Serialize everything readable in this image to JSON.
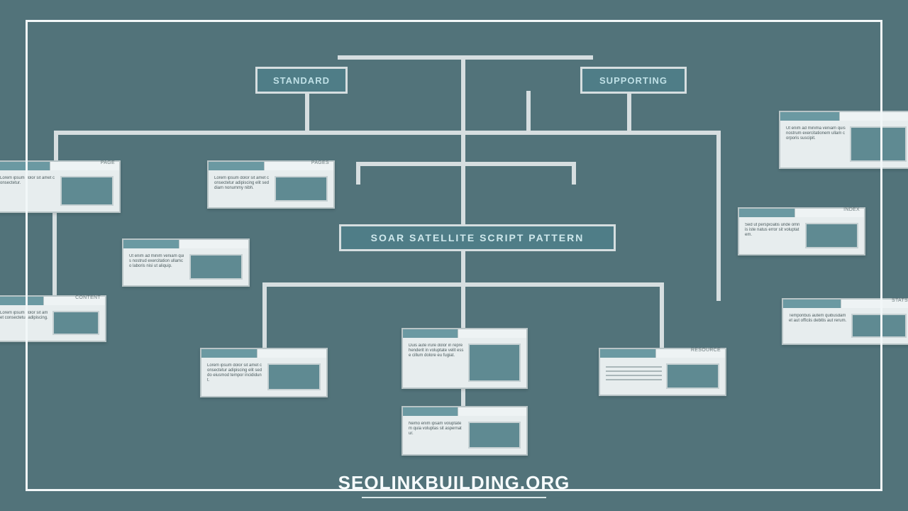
{
  "footer": {
    "site": "SEOLINKBUILDING.ORG"
  },
  "top_labels": {
    "left": "STANDARD",
    "right": "SUPPORTING"
  },
  "center_label": "SOAR SATELLITE SCRIPT PATTERN",
  "cards": {
    "c1": {
      "title": "PAGE",
      "text": "Lorem ipsum dolor sit amet consectetur."
    },
    "c2": {
      "title": "PAGES",
      "text": "Lorem ipsum dolor sit amet consectetur adipiscing elit sed diam nonummy nibh."
    },
    "c3": {
      "title": "",
      "text": "Ut enim ad minim veniam quis nostrud exercitation ullamco laboris nisi ut aliquip."
    },
    "c4": {
      "title": "CONTENT",
      "text": "Lorem ipsum dolor sit amet consectetur adipiscing."
    },
    "c5": {
      "title": "",
      "text": "Lorem ipsum dolor sit amet consectetur adipiscing elit sed do eiusmod tempor incididunt."
    },
    "c6": {
      "title": "",
      "text": "Duis aute irure dolor in reprehenderit in voluptate velit esse cillum dolore eu fugiat."
    },
    "c7": {
      "title": "RESOURCE",
      "text": ""
    },
    "c8": {
      "title": "",
      "text": "Nemo enim ipsam voluptatem quia voluptas sit aspernatur."
    },
    "c9": {
      "title": "",
      "text": "Ut enim ad minima veniam quis nostrum exercitationem ullam corporis suscipit."
    },
    "c10": {
      "title": "INDEX",
      "text": "Sed ut perspiciatis unde omnis iste natus error sit voluptatem."
    },
    "c11": {
      "title": "STATS",
      "text": "Temporibus autem quibusdam et aut officiis debitis aut rerum."
    }
  }
}
